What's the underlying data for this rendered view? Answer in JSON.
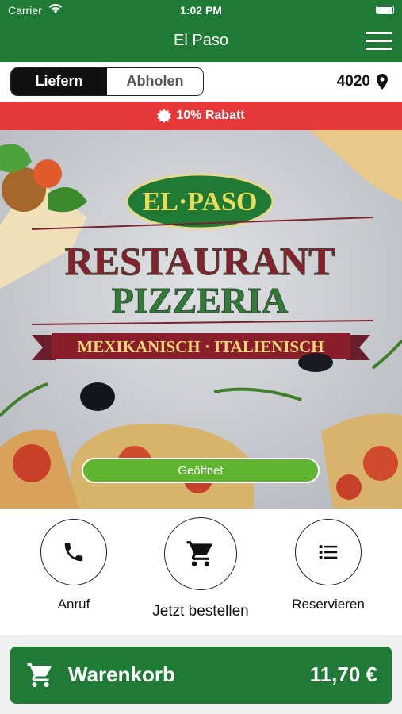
{
  "status_bar": {
    "carrier": "Carrier",
    "time": "1:02 PM"
  },
  "navbar": {
    "title": "El Paso",
    "menu_icon": "hamburger-menu-icon"
  },
  "order_mode": {
    "options": [
      "Liefern",
      "Abholen"
    ],
    "selected": "Liefern"
  },
  "location": {
    "postal_code": "4020",
    "icon": "location-pin-icon"
  },
  "discount": {
    "label": "10% Rabatt",
    "icon": "badge-icon"
  },
  "hero": {
    "logo_text": "EL·PASO",
    "line1": "RESTAURANT",
    "line2": "PIZZERIA",
    "banner": "MEXIKANISCH · ITALIENISCH",
    "status_button": "Geöffnet"
  },
  "actions": [
    {
      "label": "Anruf",
      "icon": "phone-icon"
    },
    {
      "label": "Jetzt bestellen",
      "icon": "cart-icon"
    },
    {
      "label": "Reservieren",
      "icon": "list-icon"
    }
  ],
  "cart": {
    "label": "Warenkorb",
    "price": "11,70 €",
    "icon": "cart-icon"
  },
  "colors": {
    "primary": "#1e7a34",
    "discount": "#e63838",
    "open": "#5fb530"
  }
}
